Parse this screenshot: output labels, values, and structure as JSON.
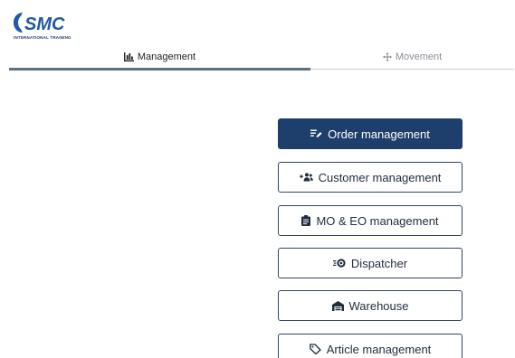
{
  "brand": {
    "logo_text": "SMC",
    "tagline": "INTERNATIONAL TRAINING",
    "color": "#1f5aa6"
  },
  "tabs": [
    {
      "label": "Management",
      "icon": "bar-chart-icon",
      "active": true
    },
    {
      "label": "Movement",
      "icon": "move-arrows-icon",
      "active": false
    }
  ],
  "menu": [
    {
      "label": "Order management",
      "icon": "edit-list-icon",
      "active": true
    },
    {
      "label": "Customer management",
      "icon": "users-add-icon",
      "active": false
    },
    {
      "label": "MO & EO management",
      "icon": "clipboard-icon",
      "active": false
    },
    {
      "label": "Dispatcher",
      "icon": "dispatch-gear-icon",
      "active": false
    },
    {
      "label": "Warehouse",
      "icon": "warehouse-icon",
      "active": false
    },
    {
      "label": "Article management",
      "icon": "tag-icon",
      "active": false
    }
  ],
  "colors": {
    "active_button": "#1e3f6b",
    "button_border": "#33475f",
    "tab_active_line": "#5d6f82",
    "tab_inactive_text": "#8a8f96"
  }
}
